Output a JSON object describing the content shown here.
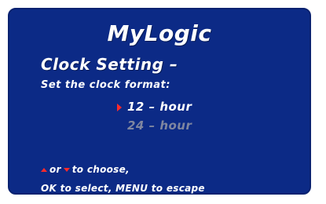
{
  "app": {
    "title": "MyLogic"
  },
  "menu": {
    "heading": "Clock Setting –",
    "prompt": "Set the clock format:",
    "options": [
      {
        "label": "12 – hour",
        "selected": true
      },
      {
        "label": "24 – hour",
        "selected": false
      }
    ]
  },
  "footer": {
    "or_text": "or",
    "choose_text": "to choose,",
    "line2": "OK to select, MENU to escape"
  },
  "icons": {
    "pointer": "selection-pointer-icon",
    "up": "up-arrow-icon",
    "down": "down-arrow-icon"
  },
  "colors": {
    "background": "#0c2a86",
    "text": "#ffffff",
    "disabled_text": "#7f86a0",
    "accent": "#ff2a2a"
  }
}
